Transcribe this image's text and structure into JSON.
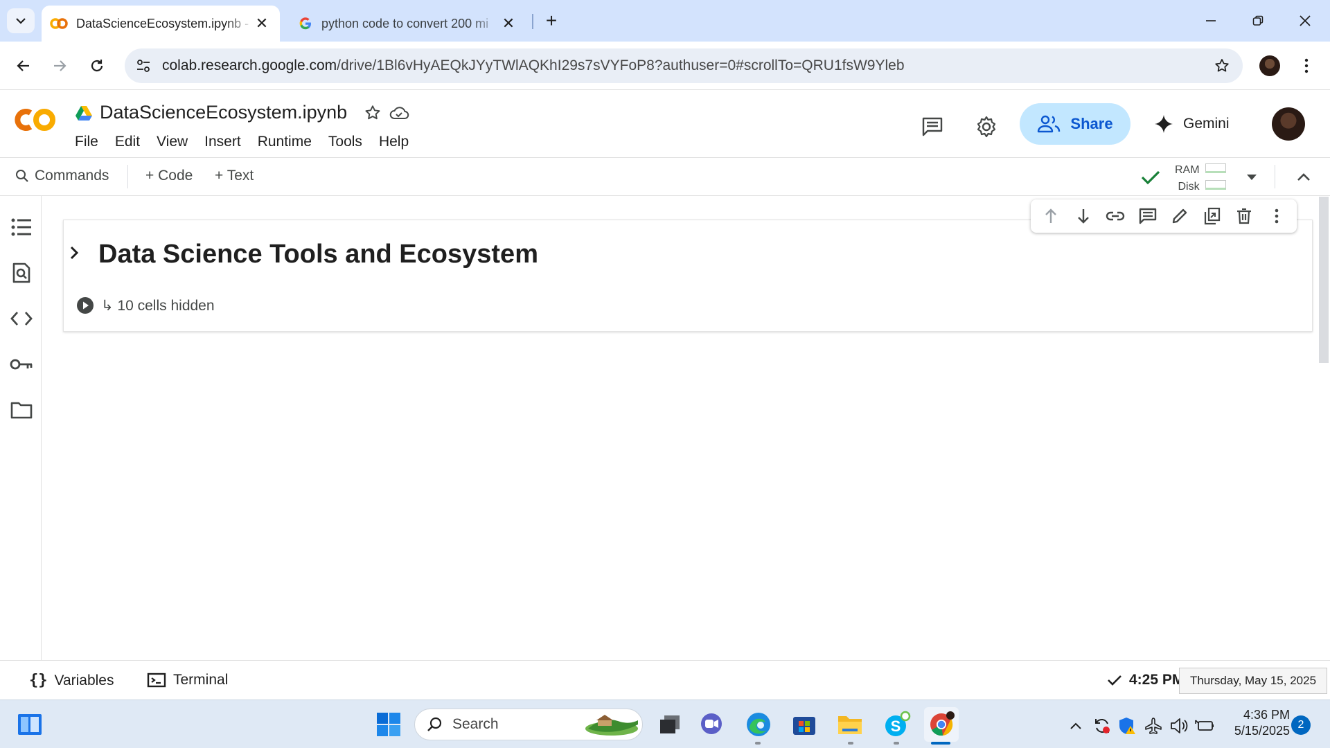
{
  "browser": {
    "tabs": [
      {
        "title": "DataScienceEcosystem.ipynb - C",
        "active": true
      },
      {
        "title": "python code to convert 200 mi",
        "active": false
      }
    ],
    "url_host": "colab.research.google.com",
    "url_path": "/drive/1Bl6vHyAEQkJYyTWlAQKhI29s7sVYFoP8?authuser=0#scrollTo=QRU1fsW9Yleb"
  },
  "colab": {
    "notebook_name": "DataScienceEcosystem.ipynb",
    "menu": [
      "File",
      "Edit",
      "View",
      "Insert",
      "Runtime",
      "Tools",
      "Help"
    ],
    "share_label": "Share",
    "gemini_label": "Gemini",
    "toolbar": {
      "commands_label": "Commands",
      "add_code_label": "+ Code",
      "add_text_label": "+ Text",
      "ram_label": "RAM",
      "disk_label": "Disk"
    }
  },
  "notebook": {
    "heading": "Data Science Tools and Ecosystem",
    "hidden_cells": "↳ 10 cells hidden"
  },
  "statusbar": {
    "variables_label": "Variables",
    "terminal_label": "Terminal",
    "exec_time": "4:25 PM",
    "date_tooltip": "Thursday, May 15, 2025"
  },
  "taskbar": {
    "search_placeholder": "Search",
    "time": "4:36 PM",
    "date": "5/15/2025",
    "notifications": "2"
  },
  "colors": {
    "tabstrip_bg": "#d3e3fd",
    "share_bg": "#c2e7ff",
    "share_fg": "#0b57d0",
    "colab_orange": "#f9ab00",
    "taskbar_bg": "#dfe9f5"
  }
}
